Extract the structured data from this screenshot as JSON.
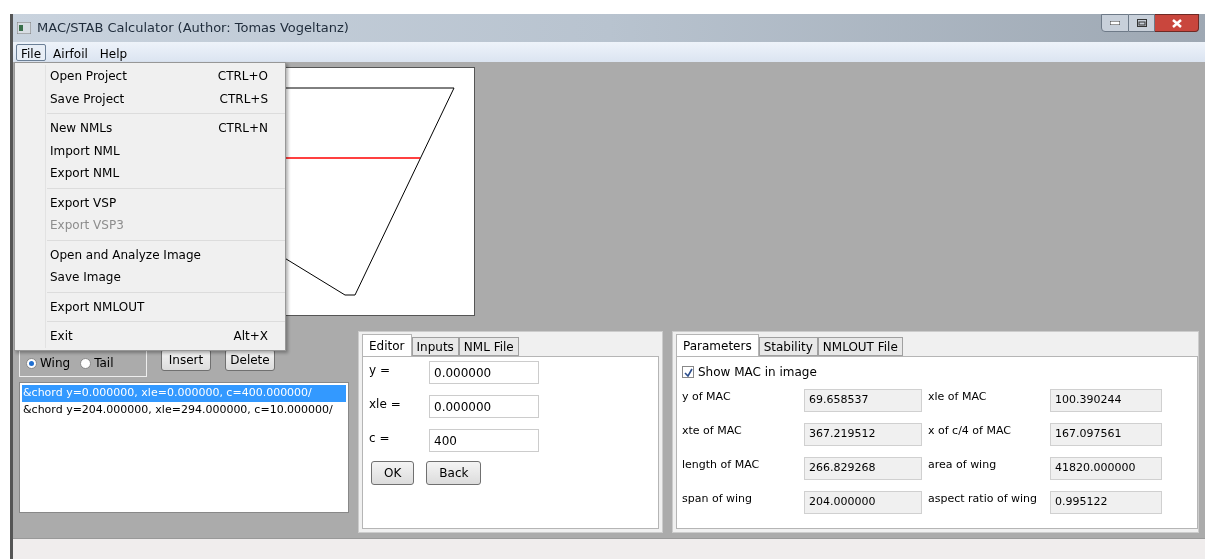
{
  "window": {
    "title": "MAC/STAB Calculator (Author: Tomas Vogeltanz)"
  },
  "menu_bar": [
    {
      "label": "File",
      "selected": true
    },
    {
      "label": "Airfoil",
      "selected": false
    },
    {
      "label": "Help",
      "selected": false
    }
  ],
  "file_menu": [
    [
      {
        "label": "Open Project",
        "shortcut": "CTRL+O",
        "disabled": false
      },
      {
        "label": "Save Project",
        "shortcut": "CTRL+S",
        "disabled": false
      }
    ],
    [
      {
        "label": "New NMLs",
        "shortcut": "CTRL+N",
        "disabled": false
      },
      {
        "label": "Import NML",
        "disabled": false
      },
      {
        "label": "Export NML",
        "disabled": false
      }
    ],
    [
      {
        "label": "Export VSP",
        "disabled": false
      },
      {
        "label": "Export VSP3",
        "disabled": true
      }
    ],
    [
      {
        "label": "Open and Analyze Image",
        "disabled": false
      },
      {
        "label": "Save Image",
        "disabled": false
      }
    ],
    [
      {
        "label": "Export NMLOUT",
        "disabled": false
      }
    ],
    [
      {
        "label": "Exit",
        "shortcut": "Alt+X",
        "disabled": false
      }
    ]
  ],
  "surface": [
    {
      "label": "Wing",
      "selected": true
    },
    {
      "label": "Tail",
      "selected": false
    }
  ],
  "buttons": [
    "Insert",
    "Delete"
  ],
  "chords": [
    {
      "text": "&chord y=0.000000, xle=0.000000, c=400.000000/",
      "selected": true
    },
    {
      "text": "&chord y=204.000000, xle=294.000000, c=10.000000/",
      "selected": false
    }
  ],
  "editor": {
    "tabs": [
      {
        "label": "Editor",
        "selected": true
      },
      {
        "label": "Inputs",
        "selected": false
      },
      {
        "label": "NML File",
        "selected": false
      }
    ],
    "fields": [
      {
        "label": "y =",
        "value": "0.000000"
      },
      {
        "label": "xle =",
        "value": "0.000000"
      },
      {
        "label": "c =",
        "value": "400"
      }
    ],
    "buttons": [
      "OK",
      "Back"
    ]
  },
  "results": {
    "tabs": [
      {
        "label": "Parameters",
        "selected": true
      },
      {
        "label": "Stability",
        "selected": false
      },
      {
        "label": "NMLOUT File",
        "selected": false
      }
    ],
    "show_mac": {
      "label": "Show MAC in image",
      "checked": true
    },
    "params": [
      {
        "label": "y of MAC",
        "value": "69.658537"
      },
      {
        "label": "xle of MAC",
        "value": "100.390244"
      },
      {
        "label": "xte of MAC",
        "value": "367.219512"
      },
      {
        "label": "x of c/4 of MAC",
        "value": "167.097561"
      },
      {
        "label": "length of MAC",
        "value": "266.829268"
      },
      {
        "label": "area of wing",
        "value": "41820.000000"
      },
      {
        "label": "span of wing",
        "value": "204.000000"
      },
      {
        "label": "aspect ratio of wing",
        "value": "0.995122"
      }
    ]
  }
}
